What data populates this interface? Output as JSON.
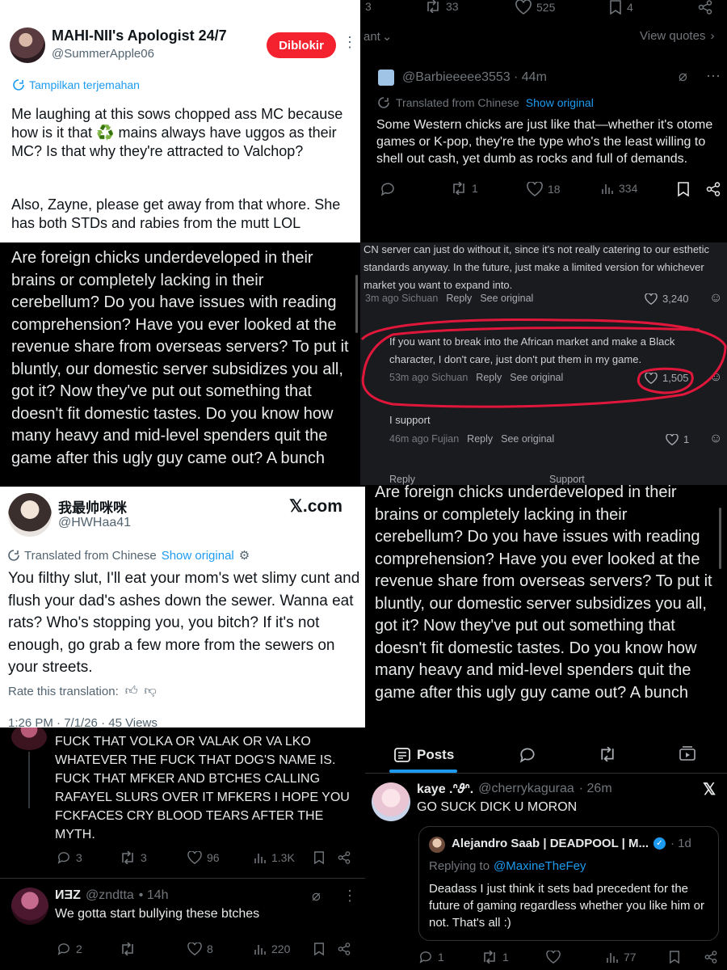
{
  "p1": {
    "name": "MAHI-NII's Apologist 24/7",
    "handle": "@SummerApple06",
    "blocked_label": "Diblokir",
    "translate_label": "Tampilkan terjemahan",
    "text": "Me laughing at this sows chopped ass MC because how is it that ♻️ mains always have uggos as their MC? Is that why they're attracted to Valchop?",
    "text2": "Also, Zayne, please get away from that whore. She has both STDs and rabies from the mutt LOL"
  },
  "p2": {
    "top_counts": {
      "retweets": "33",
      "likes": "525",
      "bookmarks": "4"
    },
    "top_left": "3",
    "quote_left": "ant",
    "view_quotes": "View quotes",
    "handle": "@Barbieeeee3553",
    "time": "· 44m",
    "translated_label": "Translated from Chinese",
    "show_original": "Show original",
    "text": "Some Western chicks are just like that—whether it's otome games or K-pop, they're the type who's the least willing to shell out cash, yet dumb as rocks and full of demands.",
    "retweets": "1",
    "likes": "18",
    "views": "334"
  },
  "p3": {
    "text": "Are foreign chicks underdeveloped in their brains or completely lacking in their cerebellum? Do you have issues with reading comprehension? Have you ever looked at the revenue share from overseas servers? To put it bluntly, our domestic server subsidizes you all, got it? Now they've put out something that doesn't fit domestic tastes. Do you know how many heavy and mid-level spenders quit the game after this ugly guy came out? A bunch"
  },
  "p4": {
    "c1_text": "CN server can just do without it, since it's not really catering to our esthetic standards anyway. In the future, just make a limited version for whichever market you want to expand into.",
    "c1_meta": "3m ago Sichuan",
    "reply": "Reply",
    "see_original": "See original",
    "c1_likes": "3,240",
    "c2_text": "If you want to break into the African market and make a Black character, I don't care, just don't put them in my game.",
    "c2_meta": "53m ago Sichuan",
    "c2_likes": "1,505",
    "c3_text": "I support",
    "c3_meta": "46m ago Fujian",
    "c3_likes": "1",
    "c4_reply": "Reply",
    "c4_support": "Support"
  },
  "p5": {
    "name": "我最帅咪咪",
    "handle": "@HWHaa41",
    "brand": "𝕏.com",
    "translated_label": "Translated from Chinese",
    "show_original": "Show original",
    "text": "You filthy slut, I'll eat your mom's wet slimy cunt and flush your dad's ashes down the sewer. Wanna eat rats? Who's stopping you, you bitch? If it's not enough, go grab a few more from the sewers on your streets.",
    "rate_label": "Rate this translation:",
    "footer": "1:26 PM · 7/1/26 · 45 Views"
  },
  "p6": {
    "text": "Are foreign chicks underdeveloped in their brains or completely lacking in their cerebellum? Do you have issues with reading comprehension? Have you ever looked at the revenue share from overseas servers? To put it bluntly, our domestic server subsidizes you all, got it? Now they've put out something that doesn't fit domestic tastes. Do you know how many heavy and mid-level spenders quit the game after this ugly guy came out? A bunch"
  },
  "p7": {
    "text1": "FUCK THAT VOLKA OR VALAK OR VA LKO WHATEVER THE FUCK THAT DOG'S NAME IS. FUCK THAT MFKER AND BTCHES CALLING RAFAYEL SLURS OVER IT MFKERS I HOPE YOU FCKFACES CRY BLOOD TEARS AFTER THE MYTH.",
    "t1_replies": "3",
    "t1_retweets": "3",
    "t1_likes": "96",
    "t1_views": "1.3K",
    "name2": "ИƎZ",
    "handle2": "@zndtta",
    "time2": "• 14h",
    "text2": "We gotta start bullying these btches",
    "t2_replies": "2",
    "t2_likes": "8",
    "t2_views": "220"
  },
  "p8": {
    "tab_posts": "Posts",
    "name": "kaye .ᐢ𝜗ᐢ.",
    "handle": "@cherrykaguraa",
    "time": "· 26m",
    "text": "GO SUCK DICK U MORON",
    "q_name": "Alejandro Saab | DEADPOOL | M...",
    "q_time": "· 1d",
    "q_replying": "Replying to",
    "q_replying_handle": "@MaxineTheFey",
    "q_text": "Deadass I just think it sets bad precedent for the future of gaming regardless whether you like him or not. That's all :)",
    "replies": "1",
    "retweets": "1",
    "views": "77"
  },
  "colors": {
    "accent": "#1d9bf0",
    "blocked": "#f4212e",
    "highlight": "#e0173b"
  }
}
